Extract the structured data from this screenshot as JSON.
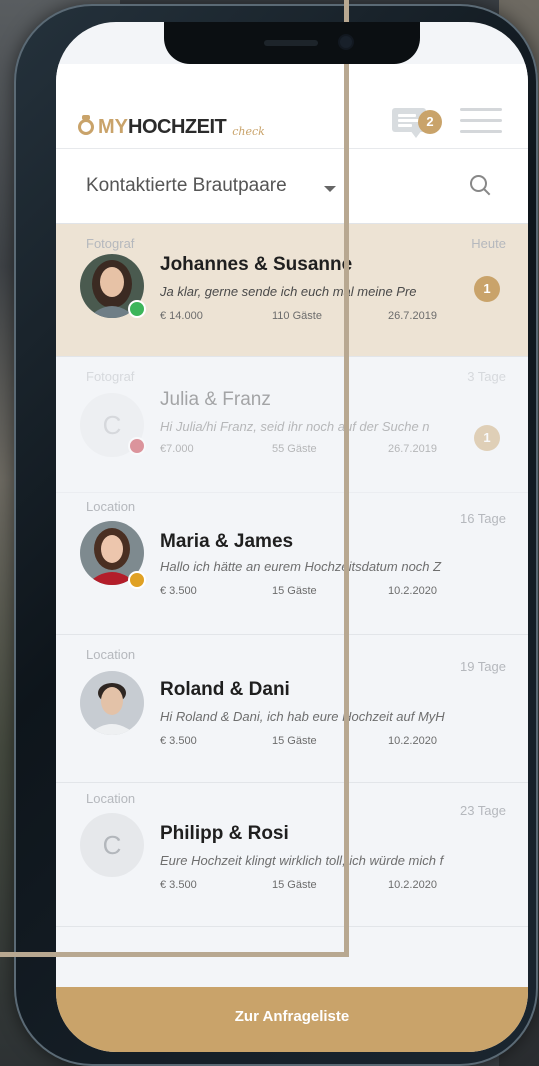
{
  "header": {
    "logo_my": "MY",
    "logo_hochzeit": "HOCHZEIT",
    "logo_sub": "check",
    "message_badge": "2",
    "icons": [
      "message-icon",
      "menu-icon"
    ]
  },
  "filter": {
    "label": "Kontaktierte Brautpaare",
    "icons": [
      "chevron-down-icon",
      "search-icon"
    ]
  },
  "conversations": [
    {
      "category": "Fotograf",
      "age": "Heute",
      "name": "Johannes & Susanne",
      "snippet": "Ja klar, gerne sende ich euch mal meine Pre",
      "price": "€ 14.000",
      "guests": "110 Gäste",
      "date": "26.7.2019",
      "unread": "1",
      "status_color": "#3cb55a",
      "active": true
    },
    {
      "category": "Fotograf",
      "age": "3 Tage",
      "name": "Julia & Franz",
      "avatar_letter": "C",
      "snippet": "Hi Julia/hi Franz, seid ihr noch auf der Suche n",
      "price": "€7.000",
      "guests": "55 Gäste",
      "date": "26.7.2019",
      "unread": "1",
      "status_color": "#c0202e"
    },
    {
      "category": "Location",
      "age": "16 Tage",
      "name": "Maria & James",
      "snippet": "Hallo ich hätte an eurem Hochzeitsdatum noch Z",
      "price": "€ 3.500",
      "guests": "15 Gäste",
      "date": "10.2.2020",
      "status_color": "#e0a124"
    },
    {
      "category": "Location",
      "age": "19 Tage",
      "name": "Roland & Dani",
      "snippet": "Hi Roland & Dani, ich hab eure Hochzeit auf MyH",
      "price": "€ 3.500",
      "guests": "15 Gäste",
      "date": "10.2.2020"
    },
    {
      "category": "Location",
      "age": "23 Tage",
      "name": "Philipp & Rosi",
      "avatar_letter": "C",
      "snippet": "Eure Hochzeit klingt wirklich toll, ich würde mich f",
      "price": "€ 3.500",
      "guests": "15 Gäste",
      "date": "10.2.2020"
    }
  ],
  "footer": {
    "button_label": "Zur Anfrageliste"
  },
  "colors": {
    "accent": "#c9a36a",
    "active_row": "#ede3d4"
  }
}
